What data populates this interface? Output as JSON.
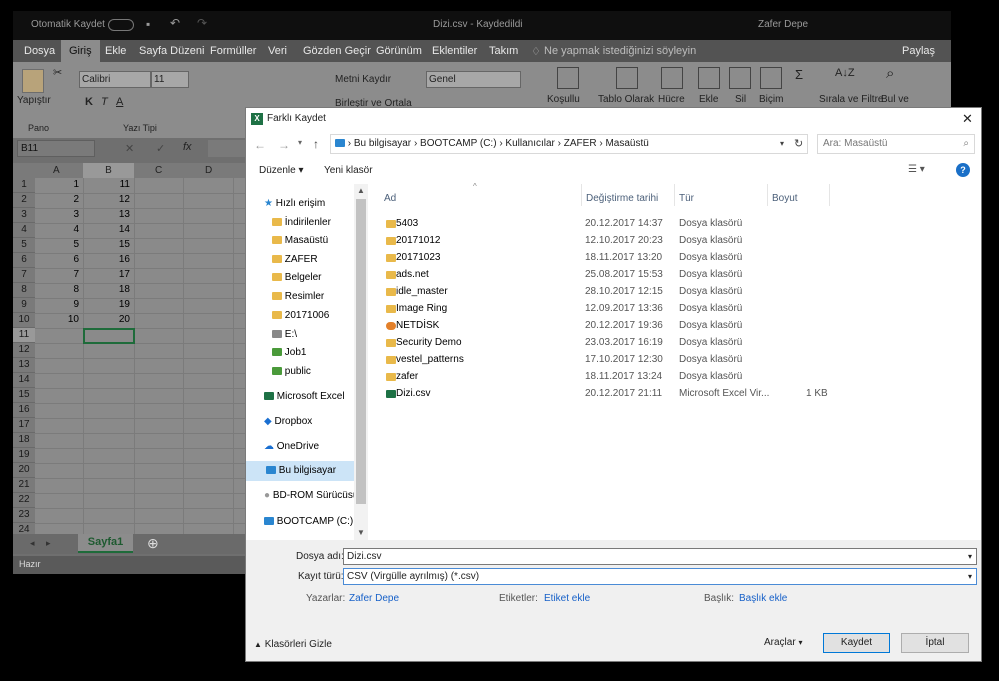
{
  "excel": {
    "autosave": "Otomatik Kaydet",
    "title": "Dizi.csv - Kaydedildi",
    "user": "Zafer Depe",
    "tabs": [
      "Dosya",
      "Giriş",
      "Ekle",
      "Sayfa Düzeni",
      "Formüller",
      "Veri",
      "Gözden Geçir",
      "Görünüm",
      "Eklentiler",
      "Takım"
    ],
    "tellme": "Ne yapmak istediğinizi söyleyin",
    "share": "Paylaş",
    "ribbon": {
      "paste": "Yapıştır",
      "clipboard": "Pano",
      "font": "Calibri",
      "size": "11",
      "font_group": "Yazı Tipi",
      "wrap": "Metni Kaydır",
      "merge": "Birleştir ve Ortala",
      "numformat": "Genel",
      "conditional": "Koşullu",
      "table": "Tablo Olarak",
      "cell": "Hücre",
      "insert": "Ekle",
      "delete": "Sil",
      "format": "Biçim",
      "sort": "Sırala ve Filtre",
      "find": "Bul ve"
    },
    "namebox": "B11",
    "fx": "fx",
    "cols": [
      "A",
      "B",
      "C",
      "D"
    ],
    "rows": [
      "1",
      "2",
      "3",
      "4",
      "5",
      "6",
      "7",
      "8",
      "9",
      "10",
      "11",
      "12",
      "13",
      "14",
      "15",
      "16",
      "17",
      "18",
      "19",
      "20",
      "21",
      "22",
      "23",
      "24"
    ],
    "colA": [
      "1",
      "2",
      "3",
      "4",
      "5",
      "6",
      "7",
      "8",
      "9",
      "10"
    ],
    "colB": [
      "11",
      "12",
      "13",
      "14",
      "15",
      "16",
      "17",
      "18",
      "19",
      "20"
    ],
    "sheet": "Sayfa1",
    "status": "Hazır"
  },
  "dialog": {
    "title": "Farklı Kaydet",
    "breadcrumb": [
      "Bu bilgisayar",
      "BOOTCAMP (C:)",
      "Kullanıcılar",
      "ZAFER",
      "Masaüstü"
    ],
    "search_placeholder": "Ara: Masaüstü",
    "organize": "Düzenle",
    "new_folder": "Yeni klasör",
    "nav": [
      "Hızlı erişim",
      "İndirilenler",
      "Masaüstü",
      "ZAFER",
      "Belgeler",
      "Resimler",
      "20171006",
      "E:\\",
      "Job1",
      "public",
      "Microsoft Excel",
      "Dropbox",
      "OneDrive",
      "Bu bilgisayar",
      "BD-ROM Sürücüsü",
      "BOOTCAMP (C:)"
    ],
    "columns": {
      "name": "Ad",
      "date": "Değiştirme tarihi",
      "type": "Tür",
      "size": "Boyut"
    },
    "files": [
      {
        "name": "5403",
        "date": "20.12.2017 14:37",
        "type": "Dosya klasörü",
        "size": ""
      },
      {
        "name": "20171012",
        "date": "12.10.2017 20:23",
        "type": "Dosya klasörü",
        "size": ""
      },
      {
        "name": "20171023",
        "date": "18.11.2017 13:20",
        "type": "Dosya klasörü",
        "size": ""
      },
      {
        "name": "ads.net",
        "date": "25.08.2017 15:53",
        "type": "Dosya klasörü",
        "size": ""
      },
      {
        "name": "idle_master",
        "date": "28.10.2017 12:15",
        "type": "Dosya klasörü",
        "size": ""
      },
      {
        "name": "Image Ring",
        "date": "12.09.2017 13:36",
        "type": "Dosya klasörü",
        "size": ""
      },
      {
        "name": "NETDİSK",
        "date": "20.12.2017 19:36",
        "type": "Dosya klasörü",
        "size": ""
      },
      {
        "name": "Security Demo",
        "date": "23.03.2017 16:19",
        "type": "Dosya klasörü",
        "size": ""
      },
      {
        "name": "vestel_patterns",
        "date": "17.10.2017 12:30",
        "type": "Dosya klasörü",
        "size": ""
      },
      {
        "name": "zafer",
        "date": "18.11.2017 13:24",
        "type": "Dosya klasörü",
        "size": ""
      },
      {
        "name": "Dizi.csv",
        "date": "20.12.2017 21:11",
        "type": "Microsoft Excel Vir...",
        "size": "1 KB"
      }
    ],
    "filename_label": "Dosya adı:",
    "filename": "Dizi.csv",
    "filetype_label": "Kayıt türü:",
    "filetype": "CSV (Virgülle ayrılmış) (*.csv)",
    "authors_label": "Yazarlar:",
    "authors": "Zafer Depe",
    "tags_label": "Etiketler:",
    "tags": "Etiket ekle",
    "title_label": "Başlık:",
    "title_value": "Başlık ekle",
    "hide_folders": "Klasörleri Gizle",
    "tools": "Araçlar",
    "save": "Kaydet",
    "cancel": "İptal"
  }
}
